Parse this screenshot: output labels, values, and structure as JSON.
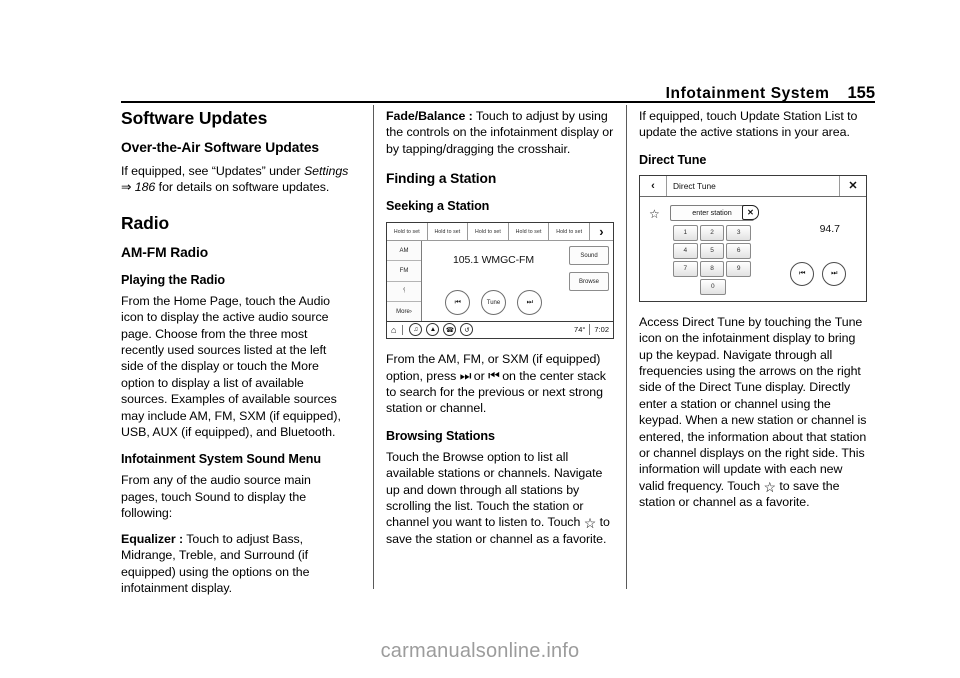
{
  "header": {
    "title": "Infotainment System",
    "page_number": "155"
  },
  "column1": {
    "h1": "Software Updates",
    "h2_ota": "Over-the-Air Software Updates",
    "p_ota_line1": "If equipped, see “Updates” under ",
    "p_ota_italic": "Settings",
    "p_ota_ref_arrow": "⇒",
    "p_ota_ref_page": "186",
    "p_ota_line2": " for details on software updates.",
    "h1_radio": "Radio",
    "h2_amfm": "AM-FM Radio",
    "h3_playing": "Playing the Radio",
    "p_playing": "From the Home Page, touch the Audio icon to display the active audio source page. Choose from the three most recently used sources listed at the left side of the display or touch the More option to display a list of available sources. Examples of available sources may include AM, FM, SXM (if equipped), USB, AUX (if equipped), and Bluetooth.",
    "h3_sound_menu": "Infotainment System Sound Menu",
    "p_sound_menu": "From any of the audio source main pages, touch Sound to display the following:",
    "eq_label": "Equalizer :",
    "eq_text": " Touch to adjust Bass, Midrange, Treble, and Surround (if equipped) using the options on the infotainment display."
  },
  "column2": {
    "fade_label": "Fade/Balance :",
    "fade_text": " Touch to adjust by using the controls on the infotainment display or by tapping/dragging the crosshair.",
    "h2_finding": "Finding a Station",
    "h3_seeking": "Seeking a Station",
    "p_seek_a": "From the AM, FM, or SXM (if equipped) option, press ",
    "p_seek_fwd": "⏭",
    "p_seek_or": " or ",
    "p_seek_rev": "⏮",
    "p_seek_b": " on the center stack to search for the previous or next strong station or channel.",
    "h3_browsing": "Browsing Stations",
    "p_browse_a": "Touch the Browse option to list all available stations or channels. Navigate up and down through all stations by scrolling the list. Touch the station or channel you want to listen to. Touch ",
    "p_browse_star": "☆",
    "p_browse_b": " to save the station or channel as a favorite.",
    "radio_figure": {
      "presets": [
        "Hold to set",
        "Hold to set",
        "Hold to set",
        "Hold to set",
        "Hold to set"
      ],
      "preset_next_icon": "›",
      "sources": [
        "AM",
        "FM",
        "ᛩ",
        "More›"
      ],
      "station": "105.1 WMGC-FM",
      "transport": {
        "prev": "⏮",
        "tune": "Tune",
        "next": "⏭"
      },
      "right_buttons": [
        "Sound",
        "Browse"
      ],
      "statusbar": {
        "home_icon": "⌂",
        "icons": [
          "♫",
          "▲",
          "☎",
          "↺"
        ],
        "temperature": "74°",
        "clock": "7:02"
      }
    }
  },
  "column3": {
    "p_update": "If equipped, touch Update Station List to update the active stations in your area.",
    "h3_direct_tune": "Direct Tune",
    "p_access_a": "Access Direct Tune by touching the Tune icon on the infotainment display to bring up the keypad. Navigate through all frequencies using the arrows on the right side of the Direct Tune display. Directly enter a station or channel using the keypad. When a new station or channel is entered, the information about that station or channel displays on the right side. This information will update with each new valid frequency. Touch ",
    "p_access_star": "☆",
    "p_access_b": " to save the station or channel as a favorite.",
    "tune_figure": {
      "back_icon": "‹",
      "title": "Direct Tune",
      "close_icon": "✕",
      "favorite_icon": "☆",
      "entry_placeholder": "enter station",
      "backspace_icon": "✕",
      "keys": [
        [
          "1",
          "2",
          "3"
        ],
        [
          "4",
          "5",
          "6"
        ],
        [
          "7",
          "8",
          "9"
        ]
      ],
      "key_zero": "0",
      "frequency": "94.7",
      "arrow_prev": "⏮",
      "arrow_next": "⏭"
    }
  },
  "watermark": "carmanualsonline.info"
}
